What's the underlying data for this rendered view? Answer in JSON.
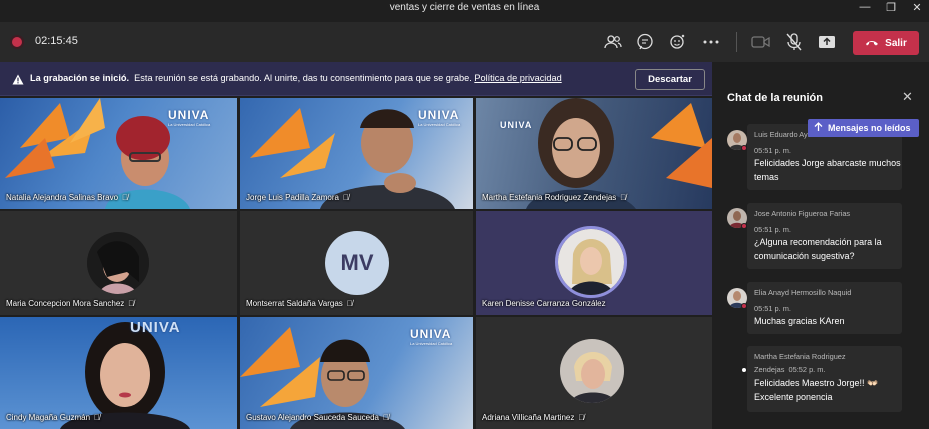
{
  "window": {
    "title": "ventas y cierre de ventas en línea"
  },
  "toolbar": {
    "timer": "02:15:45",
    "leave_label": "Salir"
  },
  "banner": {
    "heading": "La grabación se inició.",
    "message": "Esta reunión se está grabando. Al unirte, das tu consentimiento para que se grabe.",
    "link": "Política de privacidad",
    "dismiss_label": "Descartar"
  },
  "participants": [
    {
      "name": "Natalia Alejandra Salinas Bravo"
    },
    {
      "name": "Jorge Luis Padilla Zamora"
    },
    {
      "name": "Martha Estefania Rodriguez Zendejas"
    },
    {
      "name": "Maria Concepcion Mora Sanchez"
    },
    {
      "name": "Montserrat Saldaña Vargas",
      "initials": "MV"
    },
    {
      "name": "Karen Denisse Carranza González"
    },
    {
      "name": "Cindy Magaña Guzmán"
    },
    {
      "name": "Gustavo Alejandro Sauceda Sauceda"
    },
    {
      "name": "Adriana Villicaña Martinez"
    }
  ],
  "brand": {
    "logo": "UNIVA",
    "tagline": "La Universidad Católica"
  },
  "chat": {
    "title": "Chat de la reunión",
    "unread_label": "Mensajes no leídos",
    "messages": [
      {
        "author": "Luis Eduardo Ayala Salazar",
        "time": "05:51 p. m.",
        "text": "Felicidades Jorge abarcaste muchos temas"
      },
      {
        "author": "Jose Antonio Figueroa Farias",
        "time": "05:51 p. m.",
        "text": "¿Alguna recomendación para la comunicación sugestiva?"
      },
      {
        "author": "Elia Anayd Hermosillo Naquid",
        "time": "05:51 p. m.",
        "text": "Muchas gracias KAren"
      },
      {
        "author": "Martha Estefania Rodriguez",
        "author_line2": "Zendejas",
        "time": "05:52 p. m.",
        "text": "Felicidades Maestro Jorge!! 👐🏻",
        "text_line2": "Excelente ponencia"
      }
    ]
  },
  "colors": {
    "leave": "#c4314b",
    "banner": "#2d2c4e",
    "accent": "#5b5fc7",
    "univa_blue": "#1f4d9c"
  },
  "icons": [
    "participants-icon",
    "chat-icon",
    "reactions-icon",
    "more-icon",
    "camera-off-icon",
    "mic-off-icon",
    "share-icon",
    "phone-icon",
    "warning-icon",
    "close-icon",
    "arrow-up-icon",
    "mic-muted-icon"
  ]
}
